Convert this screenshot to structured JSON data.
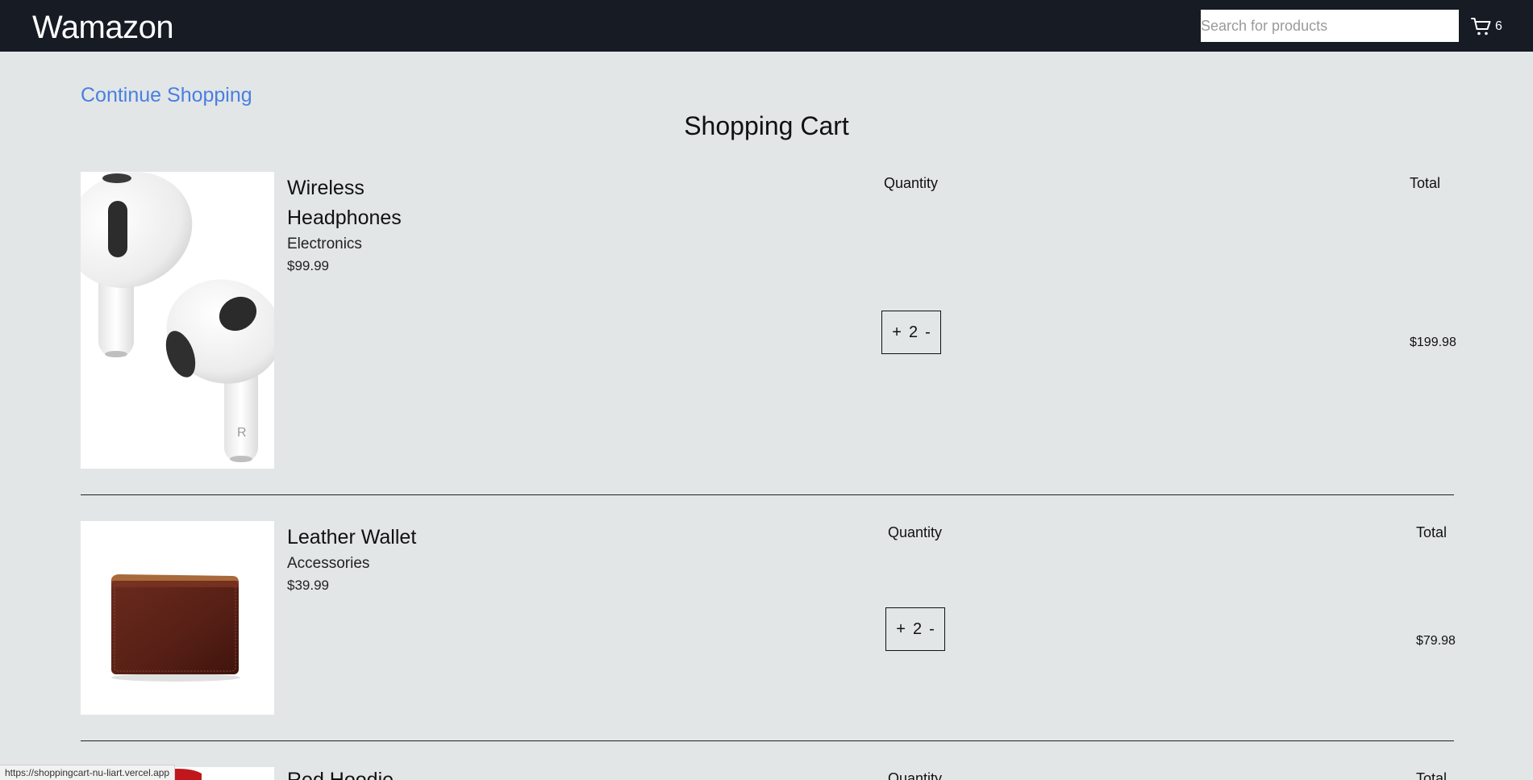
{
  "header": {
    "logo": "Wamazon",
    "search_placeholder": "Search for products",
    "cart_count": "6",
    "cart_icon": "cart-icon"
  },
  "main": {
    "continue_label": "Continue Shopping",
    "title": "Shopping Cart"
  },
  "cart": {
    "items": [
      {
        "name": "Wireless Headphones",
        "category": "Electronics",
        "price": "$99.99",
        "quantity_label": "Quantity",
        "total_label": "Total",
        "plus": "+",
        "quantity": "2",
        "minus": "-",
        "line_total": "$199.98",
        "image": "wireless-earbuds"
      },
      {
        "name": "Leather Wallet",
        "category": "Accessories",
        "price": "$39.99",
        "quantity_label": "Quantity",
        "total_label": "Total",
        "plus": "+",
        "quantity": "2",
        "minus": "-",
        "line_total": "$79.98",
        "image": "leather-wallet"
      },
      {
        "name": "Red Hoodie",
        "quantity_label": "Quantity",
        "total_label": "Total",
        "image": "red-hoodie"
      }
    ]
  },
  "status_url": "https://shoppingcart-nu-liart.vercel.app",
  "colors": {
    "header_bg": "#161b24",
    "page_bg": "#e2e6e7",
    "link": "#4a7fe0",
    "wallet": "#5a2118"
  }
}
